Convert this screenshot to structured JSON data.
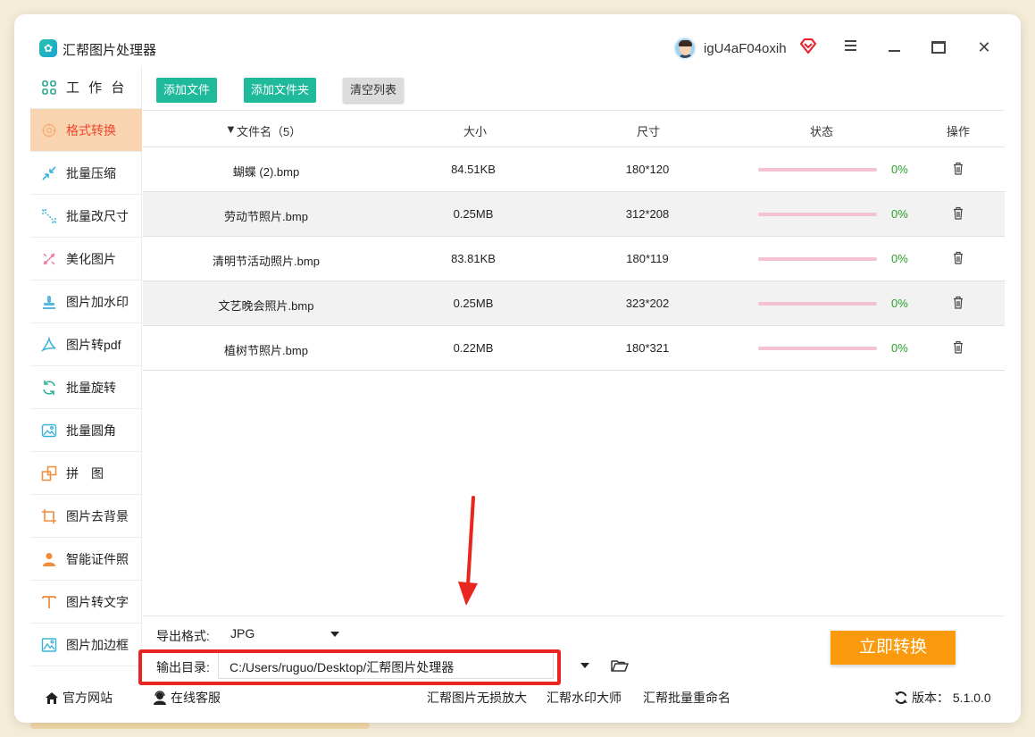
{
  "app": {
    "title": "汇帮图片处理器",
    "user_name": "igU4aF04oxih"
  },
  "sidebar": {
    "items": [
      {
        "label": "工 作 台",
        "icon": "grid-icon"
      },
      {
        "label": "格式转换",
        "icon": "convert-icon"
      },
      {
        "label": "批量压缩",
        "icon": "compress-icon"
      },
      {
        "label": "批量改尺寸",
        "icon": "resize-icon"
      },
      {
        "label": "美化图片",
        "icon": "beautify-icon"
      },
      {
        "label": "图片加水印",
        "icon": "watermark-icon"
      },
      {
        "label": "图片转pdf",
        "icon": "pdf-icon"
      },
      {
        "label": "批量旋转",
        "icon": "rotate-icon"
      },
      {
        "label": "批量圆角",
        "icon": "rounded-corner-icon"
      },
      {
        "label": "拼　图",
        "icon": "collage-icon"
      },
      {
        "label": "图片去背景",
        "icon": "crop-icon"
      },
      {
        "label": "智能证件照",
        "icon": "id-photo-icon"
      },
      {
        "label": "图片转文字",
        "icon": "text-icon"
      },
      {
        "label": "图片加边框",
        "icon": "frame-icon"
      }
    ],
    "active_index": 1
  },
  "toolbar": {
    "add_file": "添加文件",
    "add_folder": "添加文件夹",
    "clear_list": "清空列表"
  },
  "table": {
    "headers": {
      "name": "文件名（5）",
      "size": "大小",
      "dimensions": "尺寸",
      "status": "状态",
      "action": "操作"
    },
    "rows": [
      {
        "name": "蝴蝶 (2).bmp",
        "size": "84.51KB",
        "dimensions": "180*120",
        "progress": 0,
        "progress_text": "0%"
      },
      {
        "name": "劳动节照片.bmp",
        "size": "0.25MB",
        "dimensions": "312*208",
        "progress": 0,
        "progress_text": "0%"
      },
      {
        "name": "清明节活动照片.bmp",
        "size": "83.81KB",
        "dimensions": "180*119",
        "progress": 0,
        "progress_text": "0%"
      },
      {
        "name": "文艺晚会照片.bmp",
        "size": "0.25MB",
        "dimensions": "323*202",
        "progress": 0,
        "progress_text": "0%"
      },
      {
        "name": "植树节照片.bmp",
        "size": "0.22MB",
        "dimensions": "180*321",
        "progress": 0,
        "progress_text": "0%"
      }
    ]
  },
  "output": {
    "format_label": "导出格式:",
    "format_value": "JPG",
    "dir_label": "输出目录:",
    "dir_value": "C:/Users/ruguo/Desktop/汇帮图片处理器",
    "convert_button": "立即转换"
  },
  "footer": {
    "official_site": "官方网站",
    "online_service": "在线客服",
    "link1": "汇帮图片无损放大",
    "link2": "汇帮水印大师",
    "link3": "汇帮批量重命名",
    "version": "版本：  5.1.0.0"
  },
  "colors": {
    "accent_green": "#1fb99b",
    "active_bg": "#f9d4b1",
    "active_text": "#f0462d",
    "convert_orange": "#fb9a0c",
    "highlight_red": "#e8261f"
  }
}
